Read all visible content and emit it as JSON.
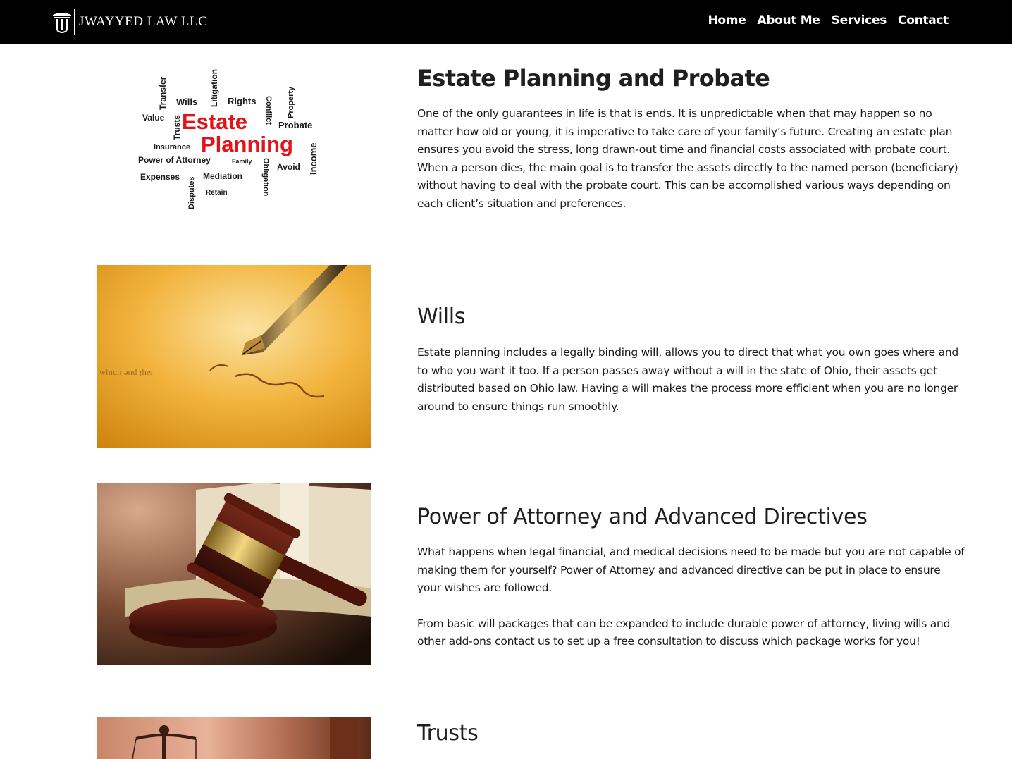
{
  "brand": {
    "name": "JWAYYED LAW LLC"
  },
  "nav": {
    "items": [
      "Home",
      "About Me",
      "Services",
      "Contact"
    ]
  },
  "colors": {
    "header_bg": "#000000",
    "text": "#1a1a1a",
    "accent_red": "#e2131b"
  },
  "wordcloud": {
    "words": {
      "estate": "Estate",
      "planning": "Planning",
      "transfer": "Transfer",
      "wills": "Wills",
      "litigation": "Litigation",
      "rights": "Rights",
      "property": "Property",
      "value": "Value",
      "trusts": "Trusts",
      "conflict": "Conflict",
      "probate": "Probate",
      "insurance": "Insurance",
      "income": "Income",
      "power_of_attorney": "Power of Attorney",
      "family": "Family",
      "avoid": "Avoid",
      "expenses": "Expenses",
      "disputes": "Disputes",
      "mediation": "Mediation",
      "obligation": "Obligation",
      "retain": "Retain"
    }
  },
  "sections": [
    {
      "title": "Estate Planning and Probate",
      "paragraphs": [
        "One of the only guarantees in life is that is ends. It is unpredictable when that may happen so no matter how old or young, it is imperative to take care of your family’s future. Creating an estate plan ensures you avoid the stress, long drawn-out time and financial costs associated with probate court. When a person dies, the main goal is to transfer the assets directly to the named person (beneficiary) without having to deal with the probate court. This can be accomplished various ways depending on each client’s situation and preferences."
      ]
    },
    {
      "title": "Wills",
      "paragraphs": [
        "Estate planning includes a legally binding will, allows you to direct that what you own goes where and to who you want it too. If a person passes away without a will in the state of Ohio, their assets get distributed based on Ohio law. Having a will makes the process more efficient when you are no longer around to ensure things run smoothly."
      ]
    },
    {
      "title": "Power of Attorney and Advanced Directives",
      "paragraphs": [
        "What happens when legal financial, and medical decisions need to be made but you are not capable of making them for yourself? Power of Attorney and advanced directive can be put in place to ensure your wishes are followed.",
        "From basic will packages that can be expanded to include durable power of attorney, living wills and other add-ons contact us to set up a free consultation to discuss which package works for you!"
      ]
    },
    {
      "title": "Trusts",
      "paragraphs": []
    }
  ]
}
